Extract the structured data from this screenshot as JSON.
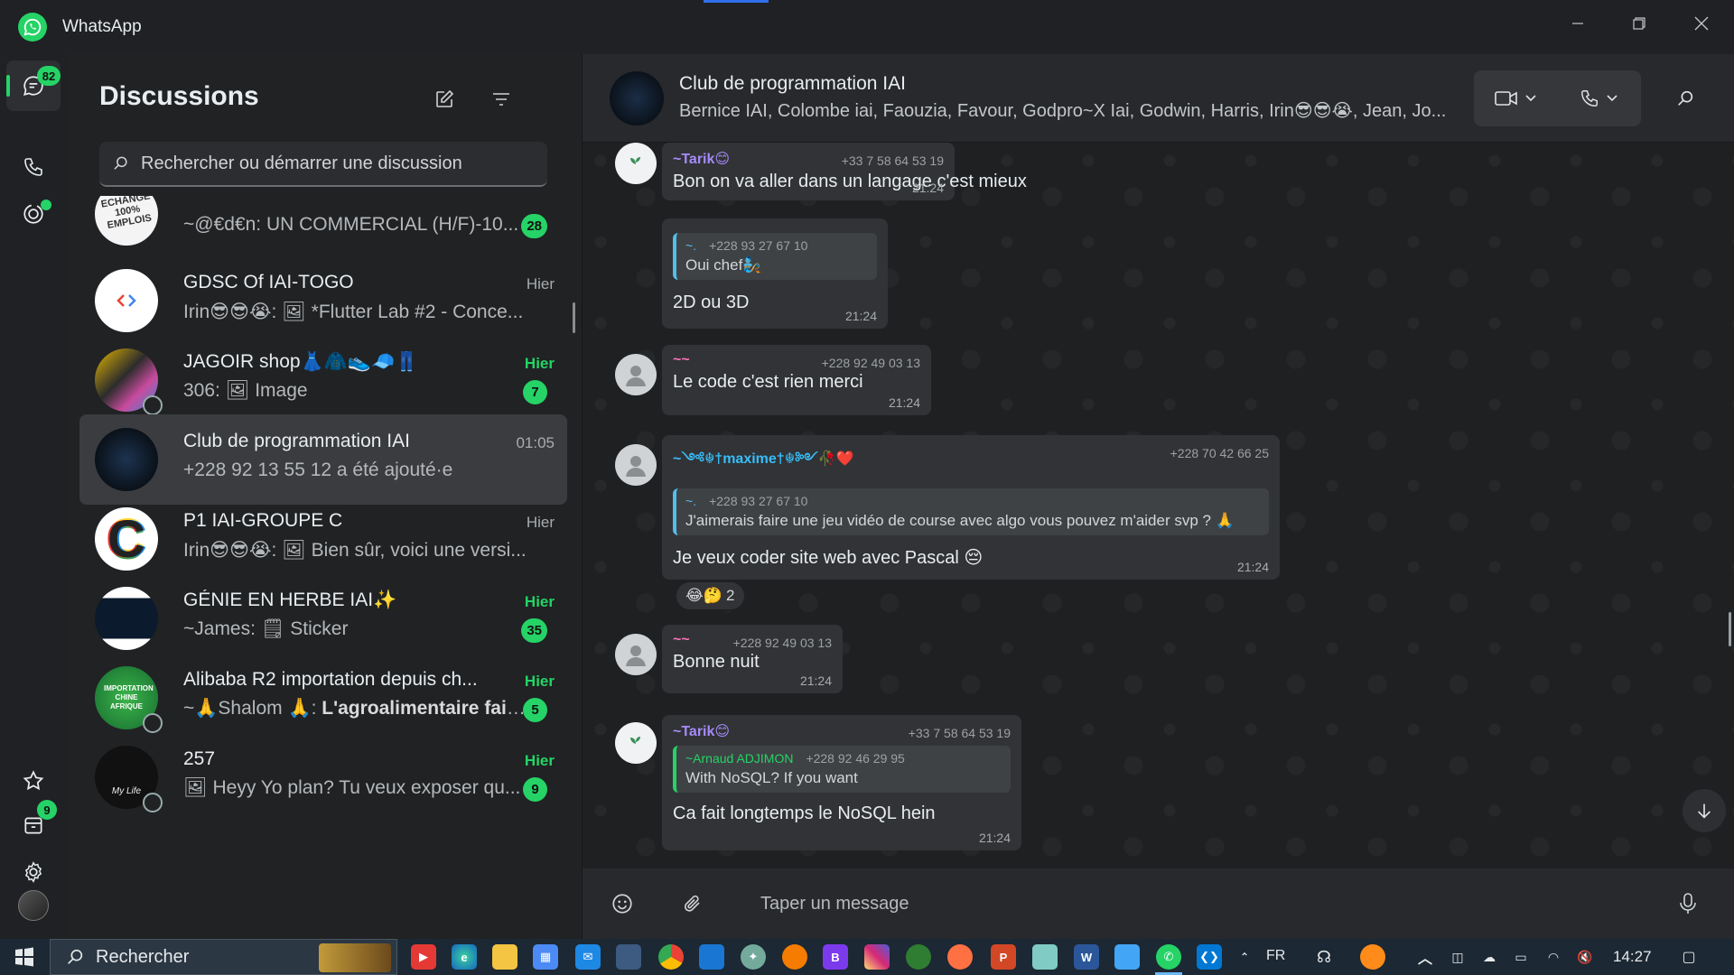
{
  "window": {
    "title": "WhatsApp",
    "icons": {
      "logo": "whatsapp-logo-icon",
      "minimize": "minimize-icon",
      "maximize": "restore-icon",
      "close": "close-icon"
    }
  },
  "rail": {
    "chats_badge": "82",
    "archive_badge": "9",
    "accent": "#25d366"
  },
  "list": {
    "title": "Discussions",
    "search_placeholder": "Rechercher ou démarrer une discussion",
    "chats": [
      {
        "name": "",
        "preview": "~@€d€n: UN COMMERCIAL (H/F)-10...",
        "time": "",
        "unread": "28",
        "avatar_text": "ECHANGE 100% EMPLOIS"
      },
      {
        "name": "GDSC Of IAI-TOGO",
        "preview": "Irin😎😎😭: 🖼 *Flutter Lab #2 - Conce...",
        "time": "Hier",
        "unread": ""
      },
      {
        "name": "JAGOIR shop👗🧥👟🧢👖",
        "preview": "306: 🖼 Image",
        "time": "Hier",
        "unread": "7"
      },
      {
        "name": "Club de programmation IAI",
        "preview": "+228 92 13 55 12 a été ajouté·e",
        "time": "01:05",
        "unread": ""
      },
      {
        "name": "P1 IAI-GROUPE C",
        "preview": "Irin😎😎😭: 🖼 Bien sûr, voici une versi...",
        "time": "Hier",
        "unread": "",
        "avatar_text": "C"
      },
      {
        "name": "GÉNIE EN HERBE IAI✨",
        "preview": "~James: 🗒 Sticker",
        "time": "Hier",
        "unread": "35"
      },
      {
        "name": "Alibaba R2 importation depuis ch...",
        "preview_prefix": "~🙏Shalom 🙏: ",
        "preview": "L'agroalimentaire fait...",
        "time": "Hier",
        "unread": "5",
        "avatar_text": "IMPORTATION CHINE AFRIQUE"
      },
      {
        "name": "257",
        "preview": "🖼 Heyy Yo plan?  Tu veux exposer qu...",
        "time": "Hier",
        "unread": "9",
        "avatar_text": "My Life"
      }
    ]
  },
  "conversation": {
    "title": "Club de programmation IAI",
    "members": "Bernice IAI, Colombe iai, Faouzia, Favour, Godpro~X Iai, Godwin, Harris, Irin😎😎😭, Jean, Jo...",
    "composer_placeholder": "Taper un message",
    "messages": [
      {
        "sender": "~Tarik😊",
        "sender_color": "#a78bfa",
        "phone": "+33 7 58 64 53 19",
        "text": "Bon on va aller dans un langage c'est mieux",
        "time": "21:24"
      },
      {
        "quote_name": "~.",
        "quote_phone": "+228 93 27 67 10",
        "quote_text": "Oui chef🧞",
        "text": "2D ou 3D",
        "time": "21:24"
      },
      {
        "sender": "~~",
        "sender_color": "#f472b6",
        "phone": "+228 92 49 03 13",
        "text": "Le code c'est rien merci",
        "time": "21:24"
      },
      {
        "sender": "~༺☬†maxime†☬༻🥀❤️",
        "sender_color": "#38bdf8",
        "phone": "+228 70 42 66 25",
        "quote_name": "~.",
        "quote_phone": "+228 93 27 67 10",
        "quote_text": "J'aimerais faire une jeu vidéo de course avec algo vous pouvez m'aider svp ? 🙏",
        "text": "Je veux coder site web avec Pascal 😔",
        "time": "21:24",
        "reactions": "😂🤔",
        "reaction_count": "2"
      },
      {
        "sender": "~~",
        "sender_color": "#f472b6",
        "phone": "+228 92 49 03 13",
        "text": "Bonne nuit",
        "time": "21:24"
      },
      {
        "sender": "~Tarik😊",
        "sender_color": "#a78bfa",
        "phone": "+33 7 58 64 53 19",
        "quote_name": "~Arnaud ADJIMON",
        "quote_phone": "+228 92 46 29 95",
        "quote_text": "With NoSQL? If you want",
        "text": "Ca fait longtemps le NoSQL hein",
        "time": "21:24"
      }
    ]
  },
  "taskbar": {
    "search_label": "Rechercher",
    "language": "FR",
    "clock": "14:27"
  }
}
